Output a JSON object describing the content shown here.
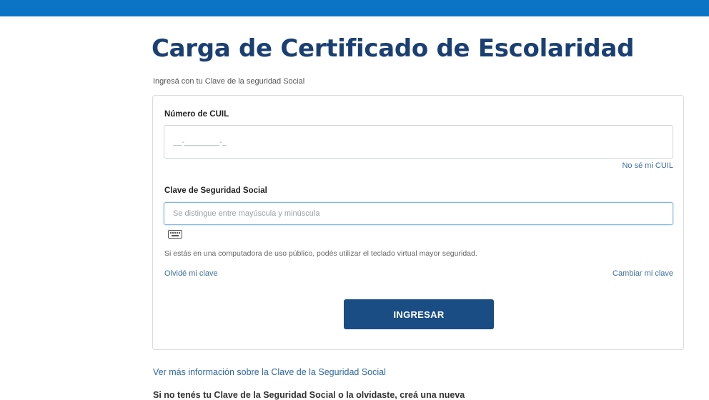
{
  "header": {
    "bar_color": "#0b74c4"
  },
  "page": {
    "title": "Carga de Certificado de Escolaridad",
    "subtitle": "Ingresá con tu Clave de la seguridad Social"
  },
  "form": {
    "cuil": {
      "label": "Número de CUIL",
      "placeholder": "__-________-_",
      "value": "",
      "help_link": "No sé mi CUIL"
    },
    "clave": {
      "label": "Clave de Seguridad Social",
      "placeholder": "Se distingue entre mayúscula y minúscula",
      "value": "",
      "keyboard_icon": "keyboard-icon",
      "hint": "Si estás en una computadora de uso público, podés utilizar el teclado virtual mayor seguridad."
    },
    "forgot_link": "Olvidé mi clave",
    "change_link": "Cambiar mi clave",
    "submit_label": "INGRESAR",
    "submit_color": "#1a4d84"
  },
  "footer": {
    "info_link": "Ver más información sobre la Clave de la Seguridad Social",
    "create_text": "Si no tenés tu Clave de la Seguridad Social o la olvidaste, creá una nueva"
  }
}
